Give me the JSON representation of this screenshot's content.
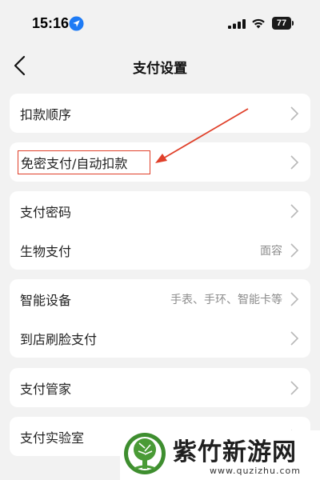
{
  "status_bar": {
    "time": "15:16",
    "battery": "77",
    "icons": [
      "location-arrow-icon",
      "cellular-signal-icon",
      "wifi-icon",
      "battery-icon"
    ]
  },
  "nav": {
    "title": "支付设置",
    "back_icon": "chevron-left-icon"
  },
  "groups": [
    {
      "items": [
        {
          "label": "扣款顺序",
          "value": ""
        }
      ]
    },
    {
      "items": [
        {
          "label": "免密支付/自动扣款",
          "value": ""
        }
      ]
    },
    {
      "items": [
        {
          "label": "支付密码",
          "value": ""
        },
        {
          "label": "生物支付",
          "value": "面容"
        }
      ]
    },
    {
      "items": [
        {
          "label": "智能设备",
          "value": "手表、手环、智能卡等"
        },
        {
          "label": "到店刷脸支付",
          "value": ""
        }
      ]
    },
    {
      "items": [
        {
          "label": "支付管家",
          "value": ""
        }
      ]
    },
    {
      "items": [
        {
          "label": "支付实验室",
          "value": ""
        }
      ]
    }
  ],
  "annotation": {
    "color": "#e0402a"
  },
  "watermark": {
    "name": "紫竹新游网",
    "url": "www.quzizhu.com"
  }
}
